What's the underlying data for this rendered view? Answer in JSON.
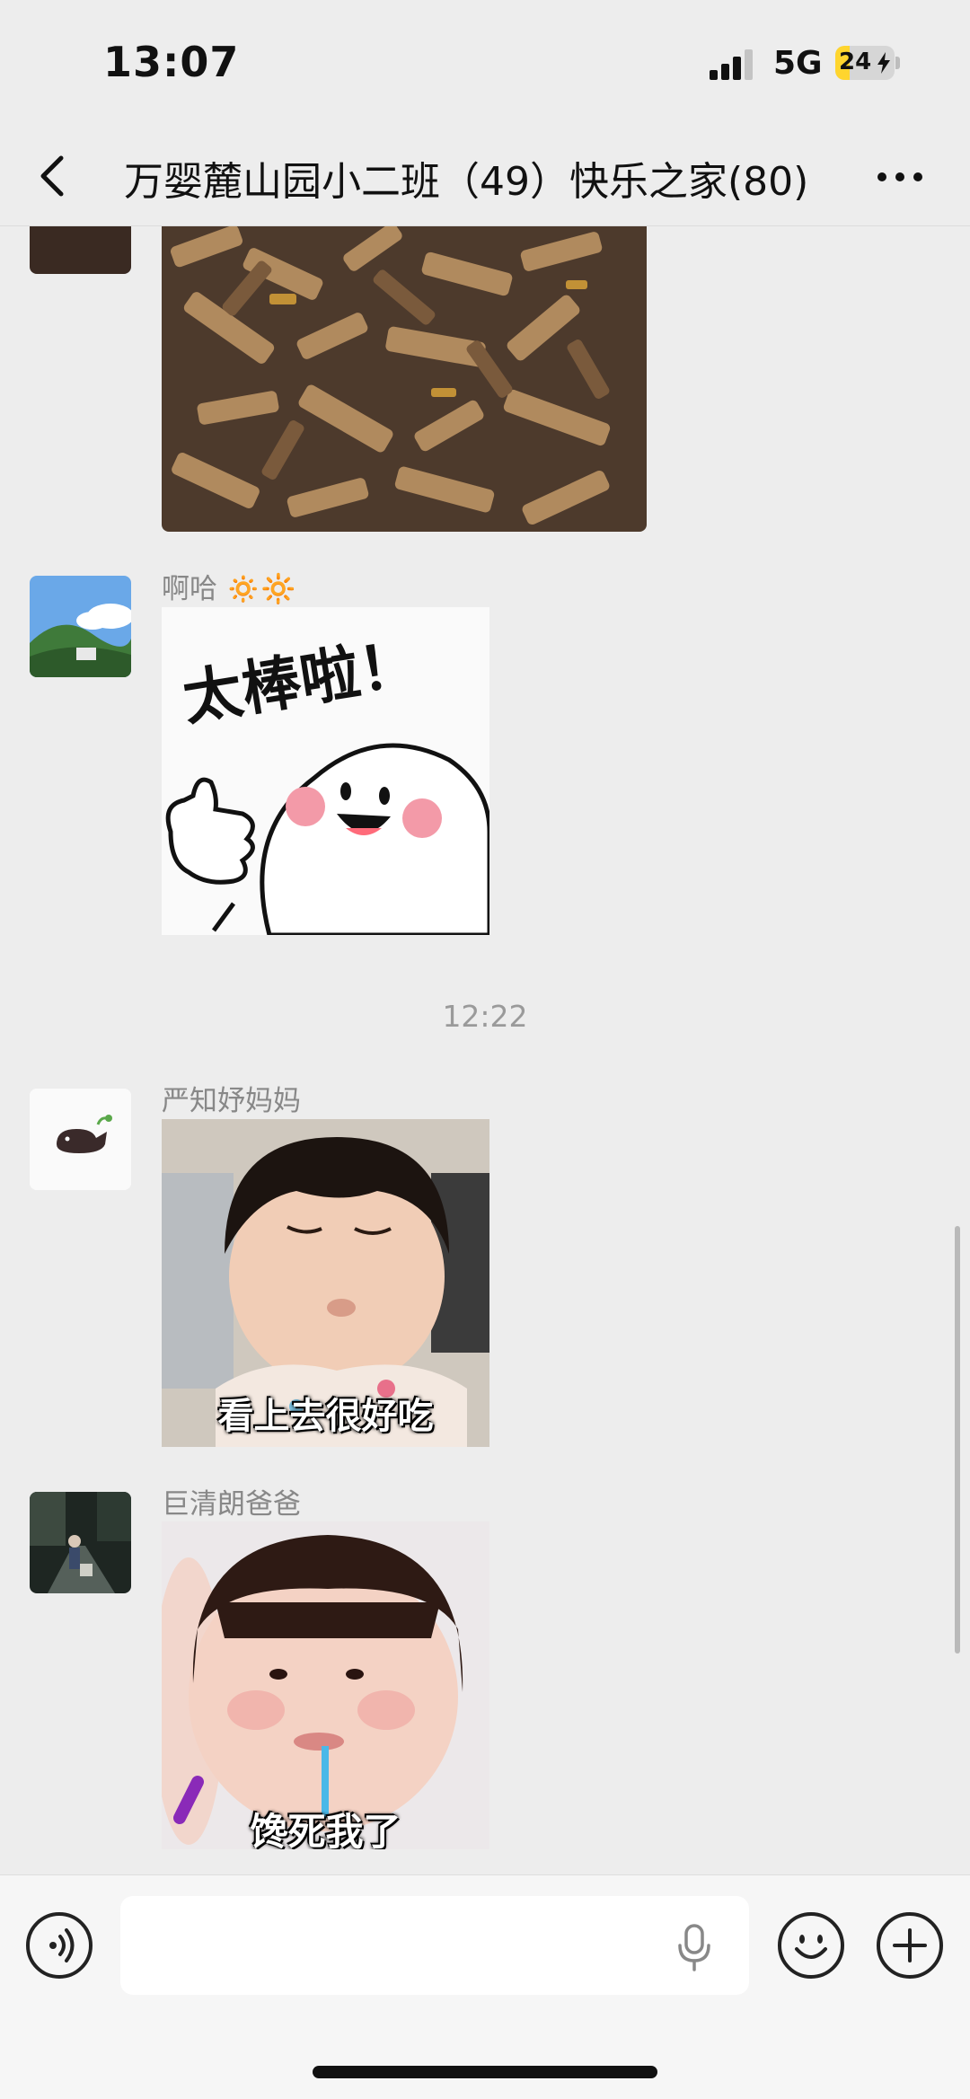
{
  "status_bar": {
    "time": "13:07",
    "network": "5G",
    "battery": "24",
    "battery_level": 0.24
  },
  "header": {
    "title": "万婴麓山园小二班（49）快乐之家(80)"
  },
  "messages": [
    {
      "type": "image",
      "content": "food-photo"
    },
    {
      "type": "sticker",
      "sender": "啊哈",
      "sender_suffix": "🔅🔆",
      "sticker_caption": "太棒啦！"
    },
    {
      "type": "time",
      "text": "12:22"
    },
    {
      "type": "sticker",
      "sender": "严知妤妈妈",
      "sticker_caption": "看上去很好吃"
    },
    {
      "type": "sticker",
      "sender": "巨清朗爸爸",
      "sticker_caption": "馋死我了"
    }
  ],
  "input": {
    "placeholder": ""
  },
  "icons": {
    "back": "chevron-left-icon",
    "more": "more-dots-icon",
    "voice": "voice-icon",
    "mic": "mic-icon",
    "emoji": "emoji-icon",
    "plus": "plus-icon"
  }
}
